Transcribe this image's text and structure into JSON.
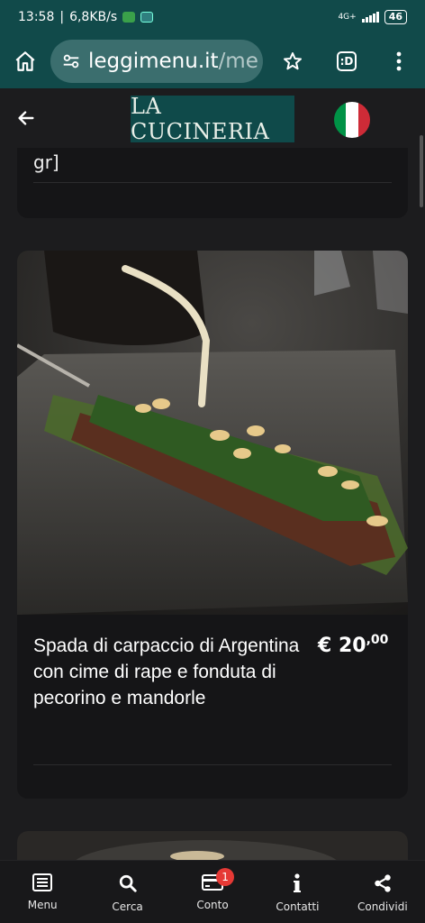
{
  "status_bar": {
    "time": "13:58",
    "network_speed": "6,8KB/s",
    "network_type": "4G+",
    "battery": "46"
  },
  "browser": {
    "url_main": "leggimenu.it",
    "url_dim": "/me",
    "tab_label": ":D",
    "icons": [
      "home-icon",
      "tune-icon",
      "star-icon",
      "more-vert-icon"
    ]
  },
  "header": {
    "logo_text": "LA CUCINERIA",
    "back_icon": "arrow-left-icon",
    "language_flag": {
      "name": "italy-flag",
      "colors": [
        "#009246",
        "#ffffff",
        "#ce2b37"
      ]
    }
  },
  "previous_item": {
    "fragment_text": "gr]"
  },
  "menu_item": {
    "name": "Spada di carpaccio di Argentina con cime di rape e fonduta di pecorino e mandorle",
    "price_main": "€ 20",
    "price_cents": ",00"
  },
  "bottom_nav": {
    "items": [
      {
        "label": "Menu",
        "icon": "menu-book-icon"
      },
      {
        "label": "Cerca",
        "icon": "search-icon"
      },
      {
        "label": "Conto",
        "icon": "credit-card-icon",
        "badge": "1"
      },
      {
        "label": "Contatti",
        "icon": "info-icon"
      },
      {
        "label": "Condividi",
        "icon": "share-icon"
      }
    ]
  },
  "colors": {
    "toolbar": "#114a4a",
    "background": "#1c1c1e",
    "card": "#151517",
    "badge": "#e53935"
  }
}
